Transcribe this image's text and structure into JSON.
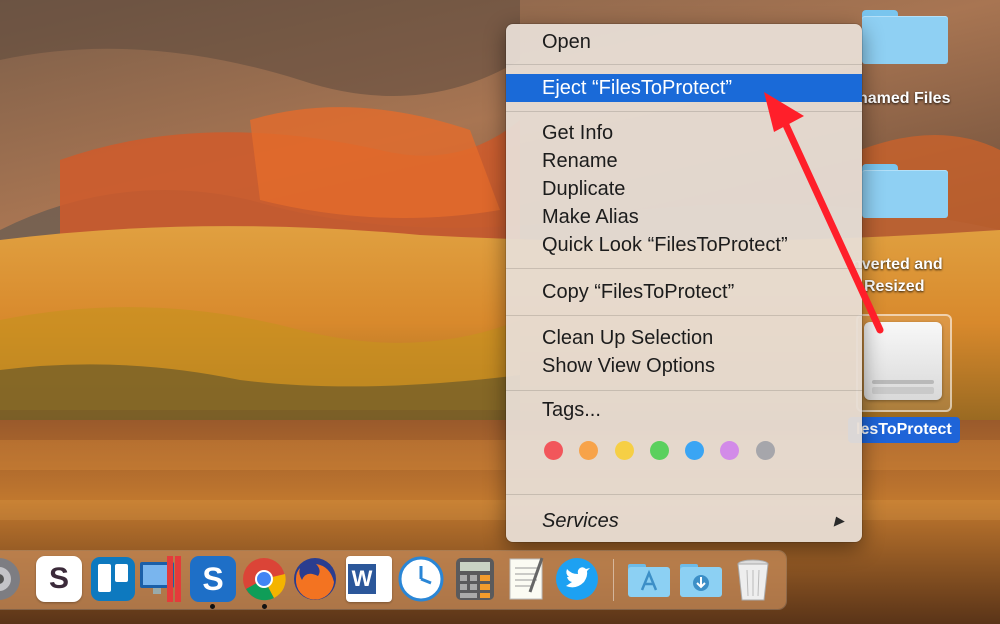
{
  "desktop": {
    "folder_labels": [
      "named Files",
      "nverted and",
      "Resized"
    ],
    "drive_label": "lesToProtect"
  },
  "context_menu": {
    "items": {
      "open": "Open",
      "eject": "Eject “FilesToProtect”",
      "get_info": "Get Info",
      "rename": "Rename",
      "duplicate": "Duplicate",
      "make_alias": "Make Alias",
      "quick_look": "Quick Look “FilesToProtect”",
      "copy": "Copy “FilesToProtect”",
      "clean_up": "Clean Up Selection",
      "view_options": "Show View Options",
      "tags": "Tags...",
      "services": "Services"
    },
    "submenu_arrow": "▶",
    "highlight_color": "#1a6ad8",
    "tag_colors": [
      {
        "name": "red",
        "color": "#f2565b"
      },
      {
        "name": "orange",
        "color": "#f7a34a"
      },
      {
        "name": "yellow",
        "color": "#f6cf45"
      },
      {
        "name": "green",
        "color": "#5bd05e"
      },
      {
        "name": "blue",
        "color": "#3aa5f4"
      },
      {
        "name": "purple",
        "color": "#d28be8"
      },
      {
        "name": "gray",
        "color": "#a6a6ab"
      }
    ]
  },
  "annotation": {
    "arrow_color": "#ff1f2a"
  },
  "dock": {
    "apps": [
      "system-preferences",
      "slack",
      "trello",
      "screen-sharing",
      "snagit",
      "chrome",
      "firefox",
      "word",
      "time-machine",
      "calculator",
      "textedit",
      "twitter",
      "applications-folder",
      "downloads-folder",
      "trash"
    ],
    "snagit_label": "S",
    "slack_label": "S",
    "word_label": "W"
  }
}
